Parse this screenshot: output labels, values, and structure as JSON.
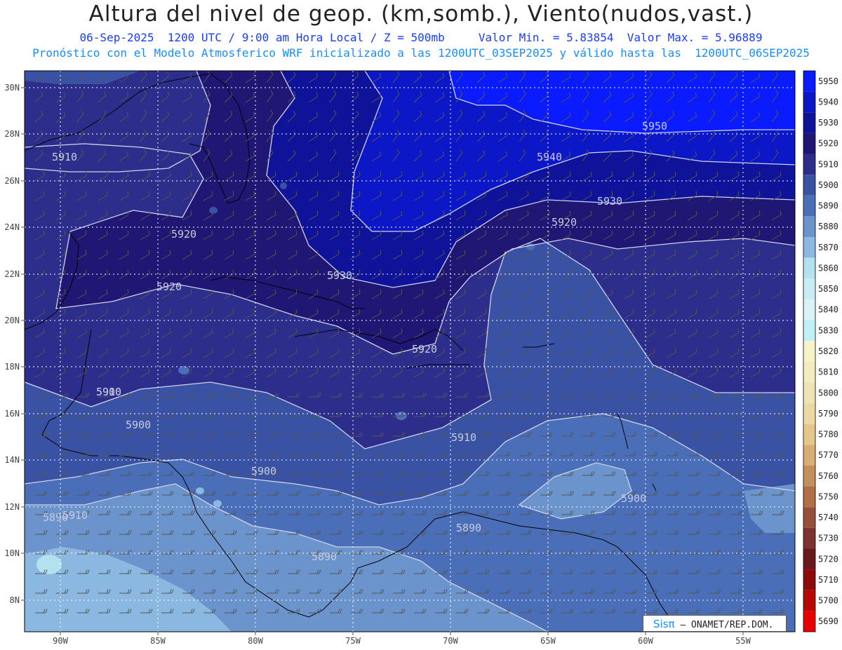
{
  "header": {
    "title": "Altura del nivel de geop. (km,somb.), Viento(nudos,vast.)",
    "date_line": "06-Sep-2025  1200 UTC / 9:00 am Hora Local / Z = 500mb     Valor Min. = 5.83854  Valor Max. = 5.96889",
    "model_line": "Pronóstico con el Modelo Atmosferico WRF inicializado a las 1200UTC_03SEP2025 y válido hasta las  1200UTC_06SEP2025"
  },
  "axes": {
    "lon_labels": [
      "90W",
      "85W",
      "80W",
      "75W",
      "70W",
      "65W",
      "60W",
      "55W"
    ],
    "lat_labels": [
      "30N",
      "28N",
      "26N",
      "24N",
      "22N",
      "20N",
      "18N",
      "16N",
      "14N",
      "12N",
      "10N",
      "8N"
    ]
  },
  "contour_labels": [
    "5950",
    "5940",
    "5930",
    "5920",
    "5930",
    "5920",
    "5920",
    "5910",
    "5910",
    "5920",
    "5910",
    "5900",
    "5900",
    "5910",
    "5890",
    "5890",
    "5890",
    "5900",
    "5900"
  ],
  "colorbar": {
    "levels": [
      "5950",
      "5940",
      "5930",
      "5920",
      "5910",
      "5900",
      "5890",
      "5880",
      "5870",
      "5860",
      "5850",
      "5840",
      "5830",
      "5820",
      "5810",
      "5800",
      "5790",
      "5780",
      "5770",
      "5760",
      "5750",
      "5740",
      "5730",
      "5720",
      "5710",
      "5700",
      "5690"
    ],
    "colors": [
      "#0a1cff",
      "#0c17c8",
      "#0f139a",
      "#1f1773",
      "#2d2e8c",
      "#3a52a3",
      "#4a6fb8",
      "#6b93cc",
      "#8ab8e0",
      "#b3e1ef",
      "#c8ecf4",
      "#d8f2f7",
      "#c0f0f5",
      "#f7f3c8",
      "#f4ecc0",
      "#f0e3b3",
      "#ecd8a3",
      "#e5c78c",
      "#d8ae76",
      "#c58f5c",
      "#b06f47",
      "#96503a",
      "#7d3430",
      "#6a1a1c",
      "#8e0a0a",
      "#b80505",
      "#e80000"
    ]
  },
  "watermark": {
    "brand": "Sisπ",
    "dash": "–",
    "org": "ONAMET/REP.DOM."
  }
}
